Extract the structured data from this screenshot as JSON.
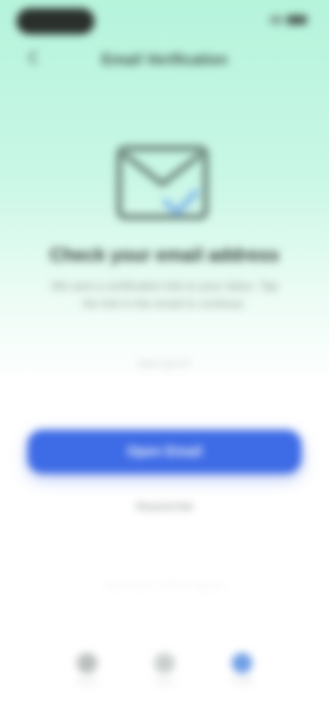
{
  "header": {
    "title": "Email Verification",
    "back_icon": "back-arrow-icon"
  },
  "illustration": {
    "icon": "envelope-check-icon",
    "colors": {
      "outline": "#5a6e66",
      "check": "#7fb6e8"
    }
  },
  "content": {
    "headline": "Check your email address",
    "subtext": "We sent a verification link to your inbox. Tap the link in the email to continue.",
    "note": "Didn't get it?"
  },
  "actions": {
    "primary_label": "Open Email",
    "secondary_label": "Resend link"
  },
  "footer": {
    "divider_text": "Need help? Contact support"
  },
  "bottom_nav": {
    "items": [
      {
        "label": "Home",
        "icon": "home-icon",
        "color": "#b9bfbd"
      },
      {
        "label": "Inbox",
        "icon": "inbox-icon",
        "color": "#c9cfcc"
      },
      {
        "label": "Profile",
        "icon": "profile-icon",
        "color": "#6f9ee6"
      }
    ]
  },
  "colors": {
    "accent": "#3e6be6",
    "background_top": "#b6f4dc"
  }
}
